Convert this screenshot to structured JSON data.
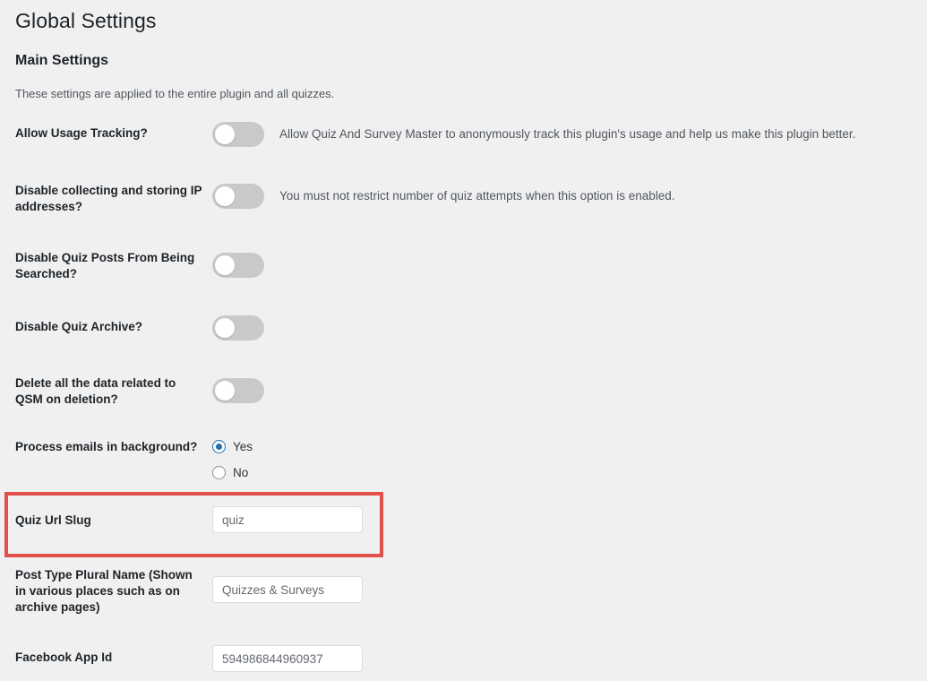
{
  "page": {
    "title": "Global Settings",
    "section_title": "Main Settings",
    "section_description": "These settings are applied to the entire plugin and all quizzes."
  },
  "settings": [
    {
      "label": "Allow Usage Tracking?",
      "control": "toggle",
      "state": "off",
      "description": "Allow Quiz And Survey Master to anonymously track this plugin's usage and help us make this plugin better."
    },
    {
      "label": "Disable collecting and storing IP addresses?",
      "control": "toggle",
      "state": "off",
      "description": "You must not restrict number of quiz attempts when this option is enabled."
    },
    {
      "label": "Disable Quiz Posts From Being Searched?",
      "control": "toggle",
      "state": "off",
      "description": ""
    },
    {
      "label": "Disable Quiz Archive?",
      "control": "toggle",
      "state": "off",
      "description": ""
    },
    {
      "label": "Delete all the data related to QSM on deletion?",
      "control": "toggle",
      "state": "off",
      "description": ""
    },
    {
      "label": "Process emails in background?",
      "control": "radio",
      "options": [
        {
          "label": "Yes",
          "checked": true
        },
        {
          "label": "No",
          "checked": false
        }
      ]
    },
    {
      "label": "Quiz Url Slug",
      "control": "text",
      "value": "quiz",
      "highlighted": true
    },
    {
      "label": "Post Type Plural Name (Shown in various places such as on archive pages)",
      "control": "text",
      "value": "Quizzes & Surveys"
    },
    {
      "label": "Facebook App Id",
      "control": "text",
      "value": "594986844960937"
    }
  ],
  "colors": {
    "background": "#f0f0f1",
    "accent": "#2271b1",
    "highlight": "#e0514b",
    "toggle_track_off": "#c9c9ca",
    "text_primary": "#1d2327",
    "text_secondary": "#50575e"
  }
}
